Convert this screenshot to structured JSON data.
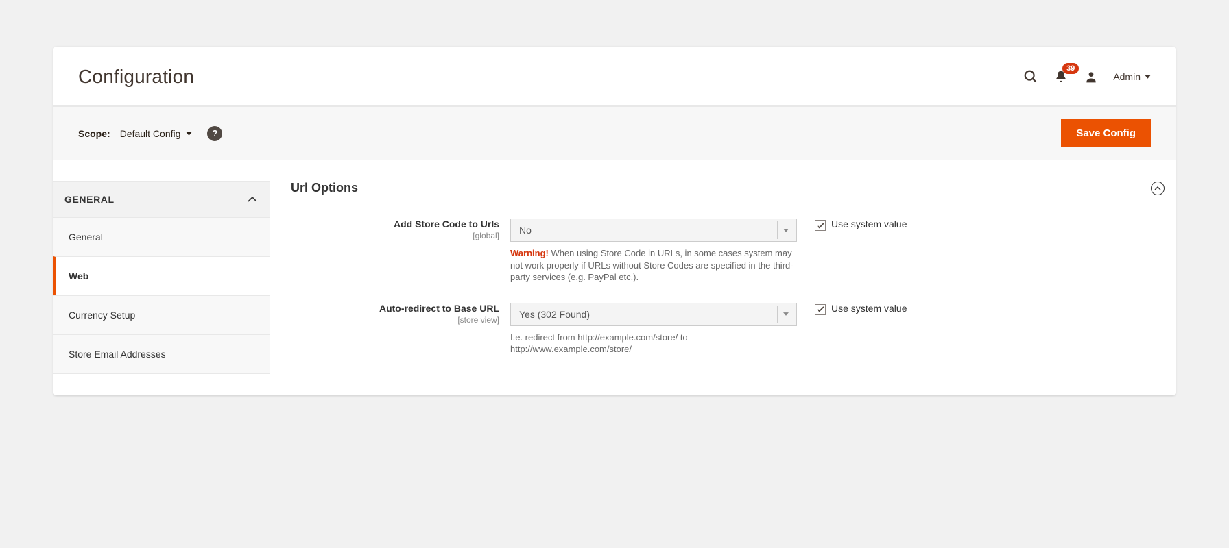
{
  "header": {
    "title": "Configuration",
    "notification_count": "39",
    "admin_label": "Admin"
  },
  "scope": {
    "label": "Scope:",
    "value": "Default Config",
    "save_button": "Save Config"
  },
  "sidebar": {
    "group": "GENERAL",
    "items": [
      {
        "label": "General"
      },
      {
        "label": "Web"
      },
      {
        "label": "Currency Setup"
      },
      {
        "label": "Store Email Addresses"
      }
    ]
  },
  "section": {
    "title": "Url Options",
    "fields": [
      {
        "label": "Add Store Code to Urls",
        "scope": "[global]",
        "value": "No",
        "warning_prefix": "Warning!",
        "note": " When using Store Code in URLs, in some cases system may not work properly if URLs without Store Codes are specified in the third-party services (e.g. PayPal etc.).",
        "checkbox_label": "Use system value"
      },
      {
        "label": "Auto-redirect to Base URL",
        "scope": "[store view]",
        "value": "Yes (302 Found)",
        "note": "I.e. redirect from http://example.com/store/ to http://www.example.com/store/",
        "checkbox_label": "Use system value"
      }
    ]
  }
}
